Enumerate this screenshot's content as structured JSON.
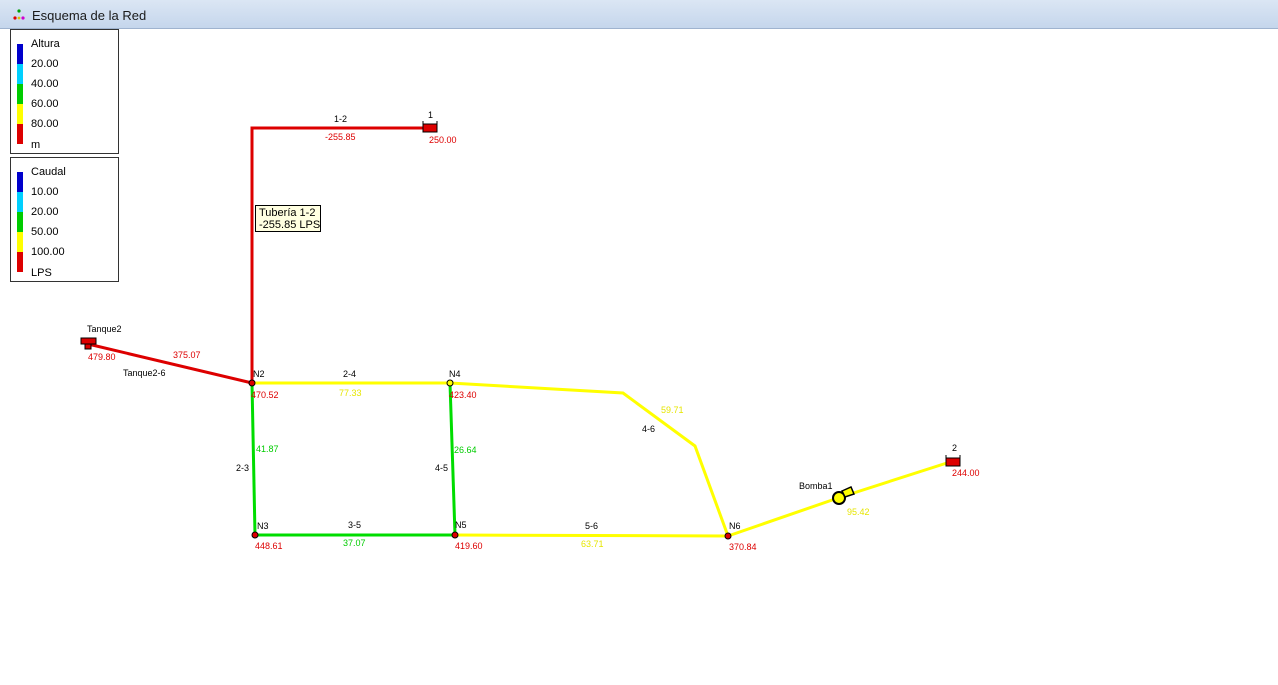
{
  "window": {
    "title": "Esquema de la Red"
  },
  "legend_altura": {
    "title": "Altura",
    "values": [
      "20.00",
      "40.00",
      "60.00",
      "80.00"
    ],
    "unit": "m",
    "colors": [
      "#0000cc",
      "#00d0ff",
      "#00cc00",
      "#ffff00",
      "#dd0000"
    ]
  },
  "legend_caudal": {
    "title": "Caudal",
    "values": [
      "10.00",
      "20.00",
      "50.00",
      "100.00"
    ],
    "unit": "LPS",
    "colors": [
      "#0000cc",
      "#00d0ff",
      "#00cc00",
      "#ffff00",
      "#dd0000"
    ]
  },
  "tooltip": {
    "line1": "Tubería 1-2",
    "line2": "-255.85 LPS"
  },
  "colors": {
    "red": "#dd0000",
    "yellow": "#ffff00",
    "green": "#00dd00"
  },
  "network": {
    "nodes": {
      "n2": {
        "name": "N2",
        "value": "470.52"
      },
      "n3": {
        "name": "N3",
        "value": "448.61"
      },
      "n4": {
        "name": "N4",
        "value": "423.40"
      },
      "n5": {
        "name": "N5",
        "value": "419.60"
      },
      "n6": {
        "name": "N6",
        "value": "370.84"
      }
    },
    "reservoirs": {
      "r1": {
        "name": "1",
        "value": "250.00"
      },
      "r2": {
        "name": "2",
        "value": "244.00"
      }
    },
    "tank": {
      "name": "Tanque2",
      "value": "479.80"
    },
    "pump": {
      "name": "Bomba1",
      "flow": "95.42"
    },
    "pipes": {
      "p12": {
        "name": "1-2",
        "flow": "-255.85"
      },
      "pt2": {
        "name": "Tanque2-6",
        "flow": "375.07"
      },
      "p24": {
        "name": "2-4",
        "flow": "77.33"
      },
      "p23": {
        "name": "2-3",
        "flow": "41.87"
      },
      "p45": {
        "name": "4-5",
        "flow": "26.64"
      },
      "p35": {
        "name": "3-5",
        "flow": "37.07"
      },
      "p46": {
        "name": "4-6",
        "flow": "59.71"
      },
      "p56": {
        "name": "5-6",
        "flow": "63.71"
      }
    }
  }
}
